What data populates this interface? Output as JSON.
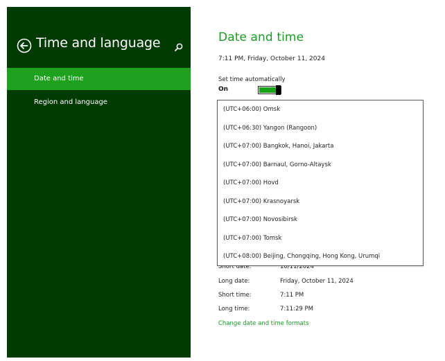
{
  "sidebar": {
    "title": "Time and language",
    "items": [
      {
        "label": "Date and time",
        "selected": true
      },
      {
        "label": "Region and language",
        "selected": false
      }
    ],
    "colors": {
      "background": "#013a03",
      "selected": "#1ea11e"
    }
  },
  "main": {
    "title": "Date and time",
    "current_time": "7:11 PM, Friday, October 11, 2024",
    "set_time_auto": {
      "label": "Set time automatically",
      "state": "On"
    },
    "timezone_options": [
      "(UTC+06:00) Omsk",
      "(UTC+06:30) Yangon (Rangoon)",
      "(UTC+07:00) Bangkok, Hanoi, Jakarta",
      "(UTC+07:00) Barnaul, Gorno-Altaysk",
      "(UTC+07:00) Hovd",
      "(UTC+07:00) Krasnoyarsk",
      "(UTC+07:00) Novosibirsk",
      "(UTC+07:00) Tomsk",
      "(UTC+08:00) Beijing, Chongqing, Hong Kong, Urumqi"
    ],
    "formats": [
      {
        "label": "Short date:",
        "value": "10/11/2024"
      },
      {
        "label": "Long date:",
        "value": "Friday, October 11, 2024"
      },
      {
        "label": "Short time:",
        "value": "7:11 PM"
      },
      {
        "label": "Long time:",
        "value": "7:11:29 PM"
      }
    ],
    "change_link": "Change date and time formats",
    "accent_color": "#1a9a24"
  },
  "icons": {
    "back": "back-arrow-circle-icon",
    "search": "search-icon"
  }
}
